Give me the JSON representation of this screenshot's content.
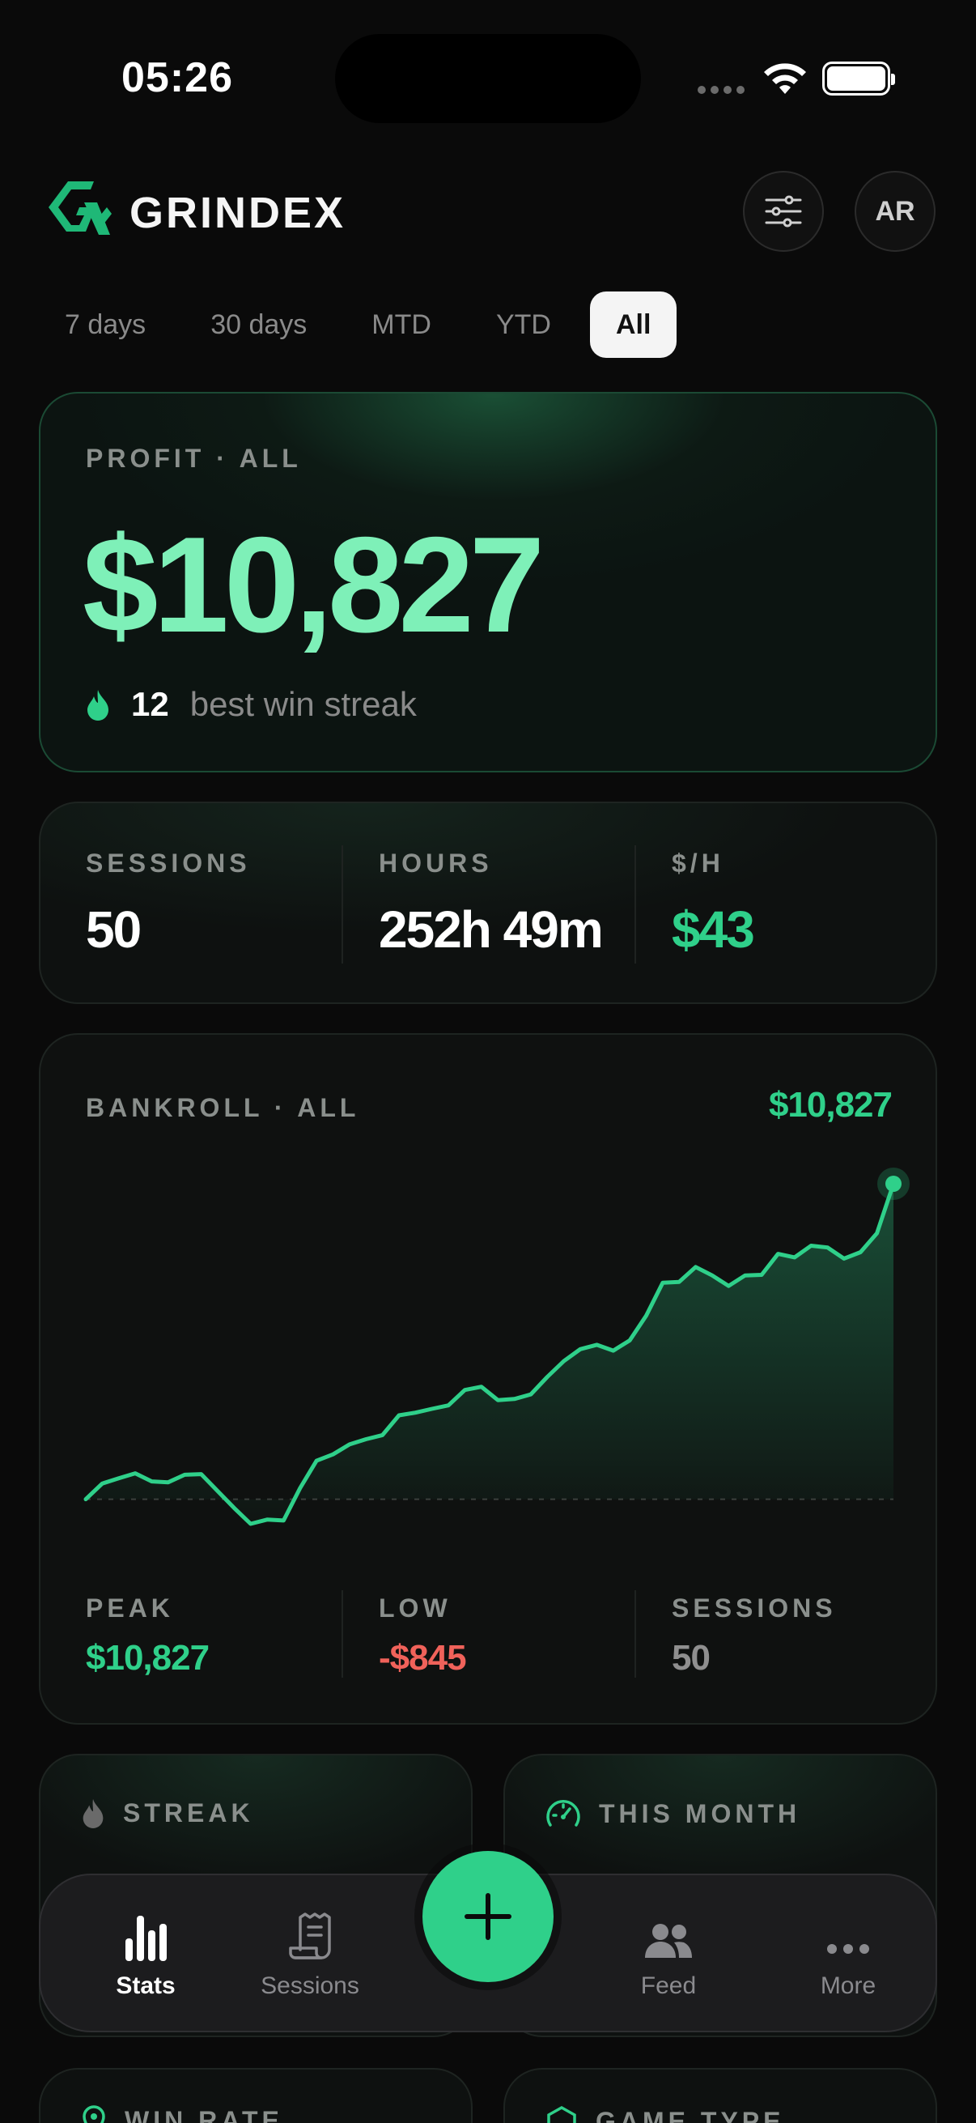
{
  "status_bar": {
    "time": "05:26"
  },
  "header": {
    "brand": "GRINDEX",
    "avatar_initials": "AR"
  },
  "range_tabs": [
    {
      "label": "7 days",
      "active": false
    },
    {
      "label": "30 days",
      "active": false
    },
    {
      "label": "MTD",
      "active": false
    },
    {
      "label": "YTD",
      "active": false
    },
    {
      "label": "All",
      "active": true
    }
  ],
  "profit_card": {
    "label": "PROFIT · ALL",
    "value": "$10,827",
    "streak_count": "12",
    "streak_text": "best win streak"
  },
  "stats_card": {
    "sessions_label": "SESSIONS",
    "sessions_value": "50",
    "hours_label": "HOURS",
    "hours_value": "252h 49m",
    "rate_label": "$/H",
    "rate_value": "$43"
  },
  "bankroll_card": {
    "label": "BANKROLL · ALL",
    "total": "$10,827",
    "peak_label": "PEAK",
    "peak_value": "$10,827",
    "low_label": "LOW",
    "low_value": "-$845",
    "sessions_label": "SESSIONS",
    "sessions_value": "50"
  },
  "chart_data": {
    "type": "area",
    "title": "",
    "xlabel": "",
    "ylabel": "",
    "x": [
      1,
      2,
      3,
      4,
      5,
      6,
      7,
      8,
      9,
      10,
      11,
      12,
      13,
      14,
      15,
      16,
      17,
      18,
      19,
      20,
      21,
      22,
      23,
      24,
      25,
      26,
      27,
      28,
      29,
      30,
      31,
      32,
      33,
      34,
      35,
      36,
      37,
      38,
      39,
      40,
      41,
      42,
      43,
      44,
      45,
      46,
      47,
      48,
      49,
      50
    ],
    "series": [
      {
        "values": [
          0,
          540,
          720,
          890,
          610,
          580,
          840,
          860,
          280,
          -300,
          -845,
          -700,
          -730,
          380,
          1320,
          1540,
          1880,
          2060,
          2200,
          2880,
          2970,
          3100,
          3220,
          3750,
          3860,
          3400,
          3440,
          3600,
          4200,
          4740,
          5150,
          5300,
          5100,
          5450,
          6300,
          7430,
          7460,
          7970,
          7680,
          7320,
          7680,
          7700,
          8420,
          8300,
          8700,
          8640,
          8260,
          8480,
          9130,
          10827
        ]
      }
    ],
    "ylim": [
      -845,
      10827
    ],
    "grid": false,
    "baseline": 0,
    "color": "#2fd08a"
  },
  "mini_cards": {
    "streak_label": "STREAK",
    "month_label": "THIS MONTH",
    "winrate_label": "WIN RATE",
    "gametype_label": "GAME TYPE"
  },
  "nav": {
    "stats": "Stats",
    "sessions": "Sessions",
    "feed": "Feed",
    "more": "More"
  },
  "colors": {
    "accent": "#2fd08a",
    "accent_light": "#7ef0b8",
    "negative": "#f0625a"
  }
}
